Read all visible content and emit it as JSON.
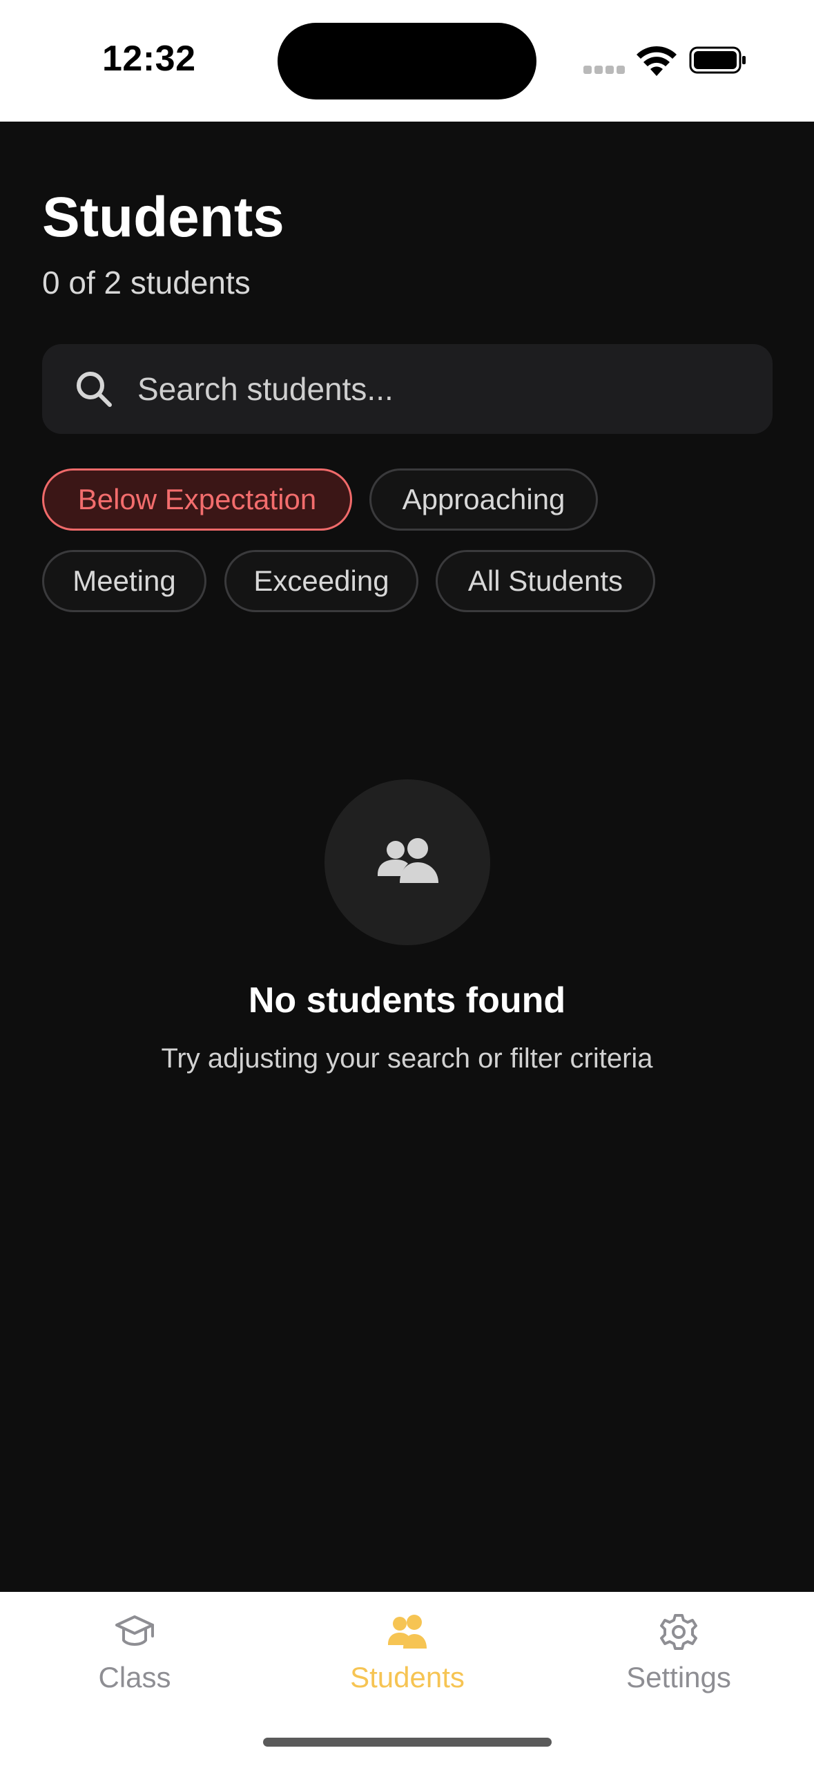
{
  "status_bar": {
    "time": "12:32"
  },
  "header": {
    "title": "Students",
    "subtitle": "0 of 2 students"
  },
  "search": {
    "placeholder": "Search students...",
    "value": ""
  },
  "filters": [
    {
      "label": "Below Expectation",
      "active": true
    },
    {
      "label": "Approaching",
      "active": false
    },
    {
      "label": "Meeting",
      "active": false
    },
    {
      "label": "Exceeding",
      "active": false
    },
    {
      "label": "All Students",
      "active": false
    }
  ],
  "empty_state": {
    "icon": "people-icon",
    "title": "No students found",
    "description": "Try adjusting your search or filter criteria"
  },
  "tab_bar": {
    "tabs": [
      {
        "label": "Class",
        "icon": "graduation-cap-icon",
        "active": false
      },
      {
        "label": "Students",
        "icon": "people-icon",
        "active": true
      },
      {
        "label": "Settings",
        "icon": "gear-icon",
        "active": false
      }
    ]
  },
  "colors": {
    "background": "#0e0e0e",
    "accent_active_tab": "#f6c453",
    "active_filter": "#f36d6d",
    "surface": "#1d1d1f"
  }
}
